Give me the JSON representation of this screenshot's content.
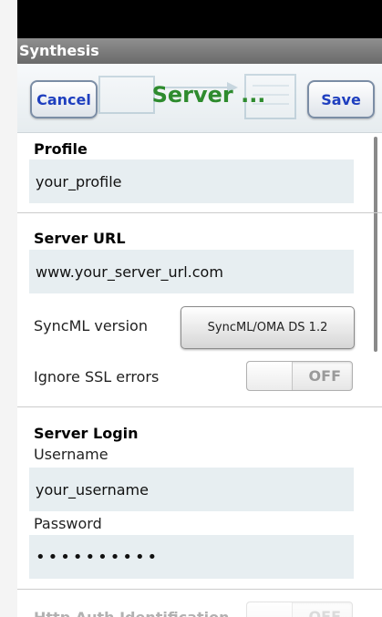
{
  "app": {
    "title": "Synthesis"
  },
  "header": {
    "cancel_label": "Cancel",
    "title": "Server ...",
    "save_label": "Save"
  },
  "profile": {
    "section_title": "Profile",
    "value": "your_profile"
  },
  "server_url": {
    "section_title": "Server URL",
    "value": "www.your_server_url.com",
    "syncml_label": "SyncML version",
    "syncml_value": "SyncML/OMA DS 1.2",
    "ssl_label": "Ignore SSL errors",
    "ssl_state": "OFF"
  },
  "server_login": {
    "section_title": "Server Login",
    "username_label": "Username",
    "username_value": "your_username",
    "password_label": "Password",
    "password_value": "••••••••••"
  },
  "http_auth": {
    "label": "Http Auth Identification",
    "state": "OFF"
  },
  "colors": {
    "title_green": "#2e8b2e",
    "button_blue": "#1f3fbf",
    "field_bg": "#e7eef1"
  }
}
